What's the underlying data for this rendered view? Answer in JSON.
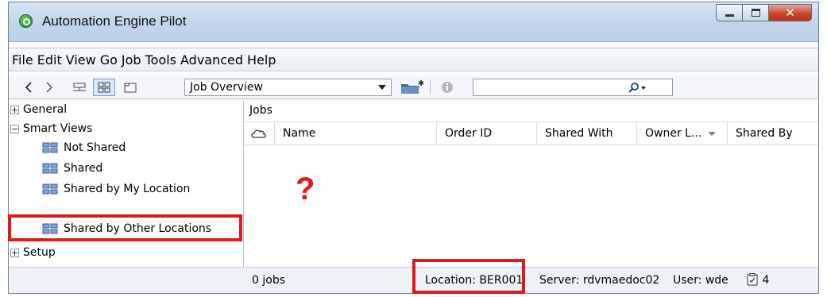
{
  "window": {
    "title": "Automation Engine Pilot"
  },
  "menu": [
    "File",
    "Edit",
    "View",
    "Go",
    "Job",
    "Tools",
    "Advanced",
    "Help"
  ],
  "toolbar": {
    "back_icon": "chevron-left-icon",
    "forward_icon": "chevron-right-icon",
    "view_select": "Job Overview",
    "search_placeholder": "",
    "search_value": ""
  },
  "tree": {
    "general": "General",
    "smart_views": "Smart Views",
    "children": [
      "Not Shared",
      "Shared",
      "Shared by My Location",
      "Shared by Other Locations"
    ],
    "setup": "Setup"
  },
  "jobs": {
    "title": "Jobs",
    "columns": [
      "Name",
      "Order ID",
      "Shared With",
      "Owner L...",
      "Shared By"
    ],
    "marker": "?"
  },
  "status": {
    "jobs_count": "0 jobs",
    "location": "Location: BER001",
    "server": "Server: rdvmaedoc02",
    "user": "User: wde",
    "tasks": "4"
  },
  "colors": {
    "highlight": "#e01a1a",
    "accent": "#6a86b8"
  }
}
